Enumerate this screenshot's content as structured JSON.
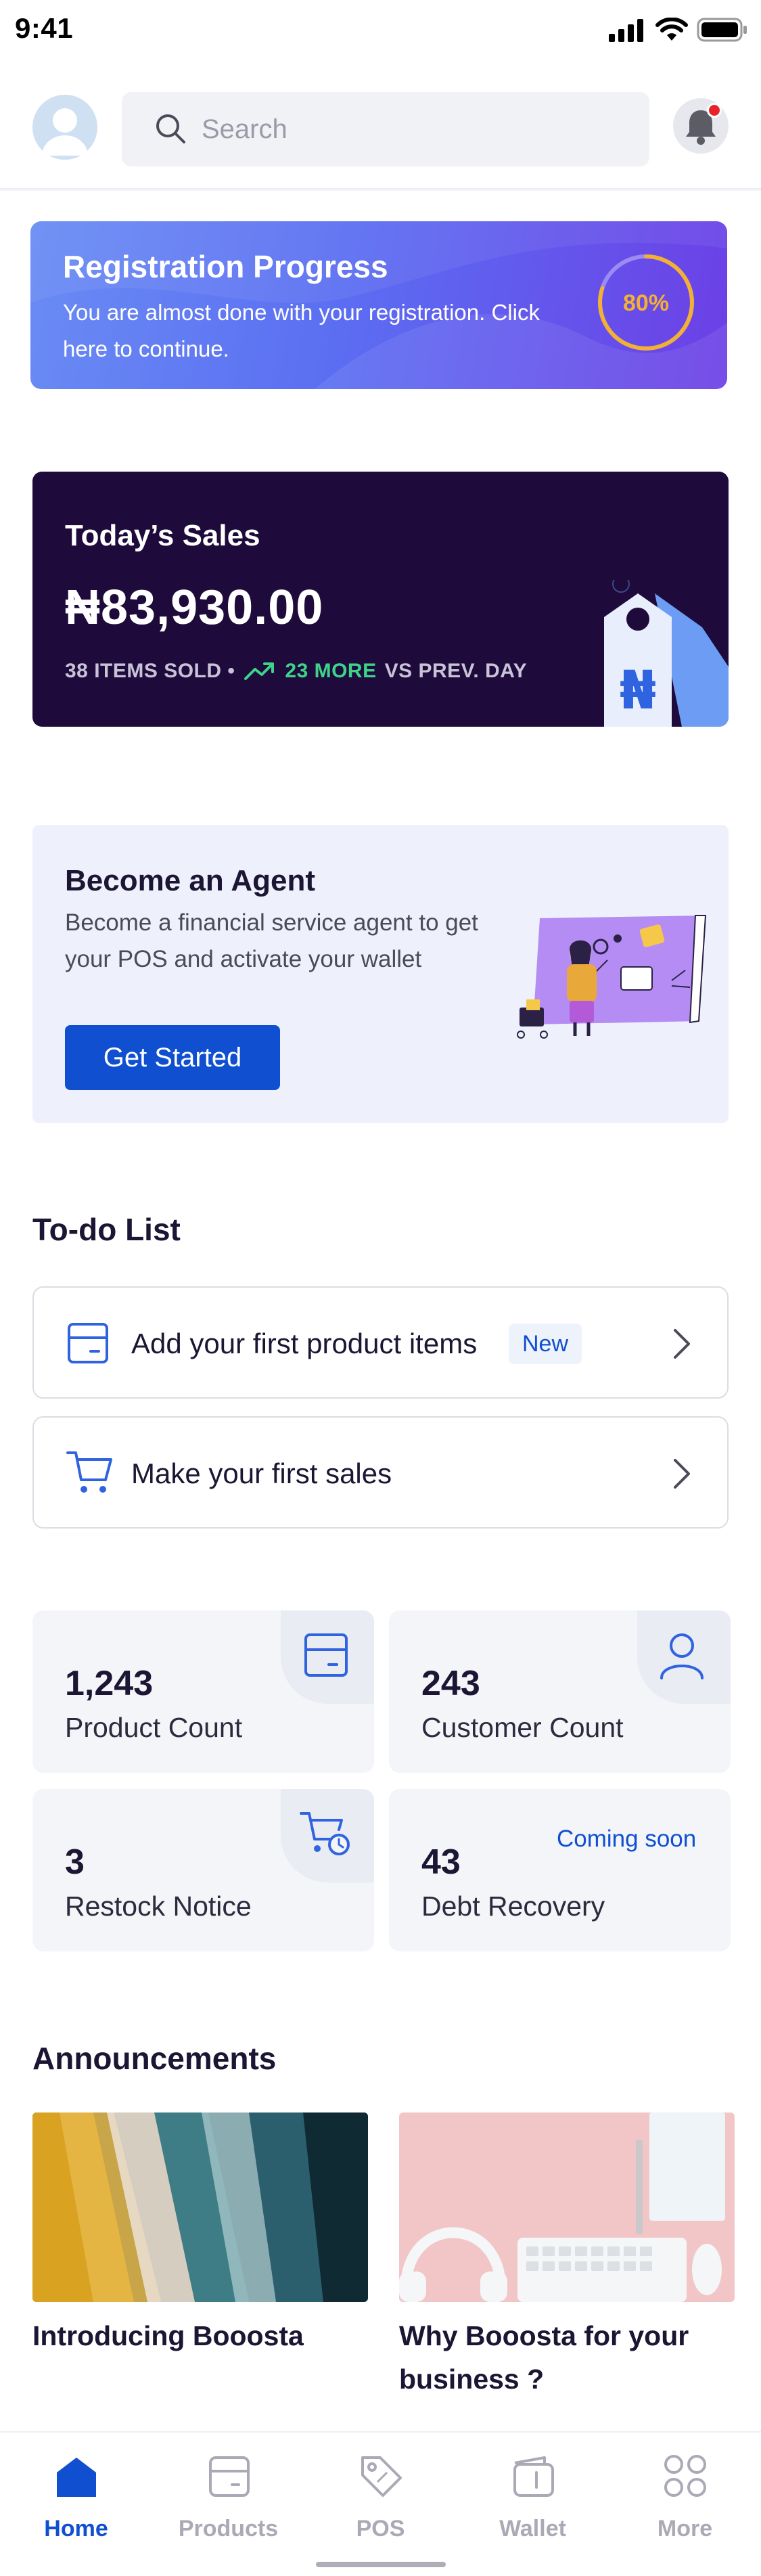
{
  "status_bar": {
    "time": "9:41"
  },
  "header": {
    "search": {
      "placeholder": "Search"
    }
  },
  "registration": {
    "title": "Registration Progress",
    "subtitle": "You are almost done with your registration. Click here to continue.",
    "percent_label": "80%",
    "progress_fraction": 0.8
  },
  "sales": {
    "title": "Today’s Sales",
    "amount": "₦83,930.00",
    "items_sold": "38 ITEMS SOLD •",
    "change": "23 MORE",
    "comparison": "VS PREV. DAY",
    "currency_symbol": "₦"
  },
  "agent": {
    "title": "Become an Agent",
    "subtitle": "Become a financial service agent to get your POS and activate your wallet",
    "button_label": "Get Started"
  },
  "todo": {
    "title": "To-do List",
    "items": [
      {
        "label": "Add your first product items",
        "badge": "New",
        "icon": "box-icon"
      },
      {
        "label": "Make your first sales",
        "icon": "cart-icon"
      }
    ]
  },
  "stats": [
    {
      "value": "1,243",
      "label": "Product Count",
      "icon": "box-icon"
    },
    {
      "value": "243",
      "label": "Customer Count",
      "icon": "user-icon"
    },
    {
      "value": "3",
      "label": "Restock Notice",
      "icon": "restock-cart-icon"
    },
    {
      "value": "43",
      "label": "Debt Recovery",
      "badge": "Coming soon"
    }
  ],
  "announcements": {
    "title": "Announcements",
    "items": [
      {
        "title": "Introducing Booosta"
      },
      {
        "title": "Why Booosta for your business ?"
      }
    ]
  },
  "tabs": [
    {
      "label": "Home",
      "icon": "home-icon",
      "active": true
    },
    {
      "label": "Products",
      "icon": "box-icon",
      "active": false
    },
    {
      "label": "POS",
      "icon": "tag-icon",
      "active": false
    },
    {
      "label": "Wallet",
      "icon": "wallet-icon",
      "active": false
    },
    {
      "label": "More",
      "icon": "grid-icon",
      "active": false
    }
  ],
  "colors": {
    "primary": "#0f4fd0",
    "sales_card": "#1e0b3b",
    "positive": "#3dd48a",
    "progress_ring": "#f2b134",
    "notification_dot": "#e8222b"
  }
}
